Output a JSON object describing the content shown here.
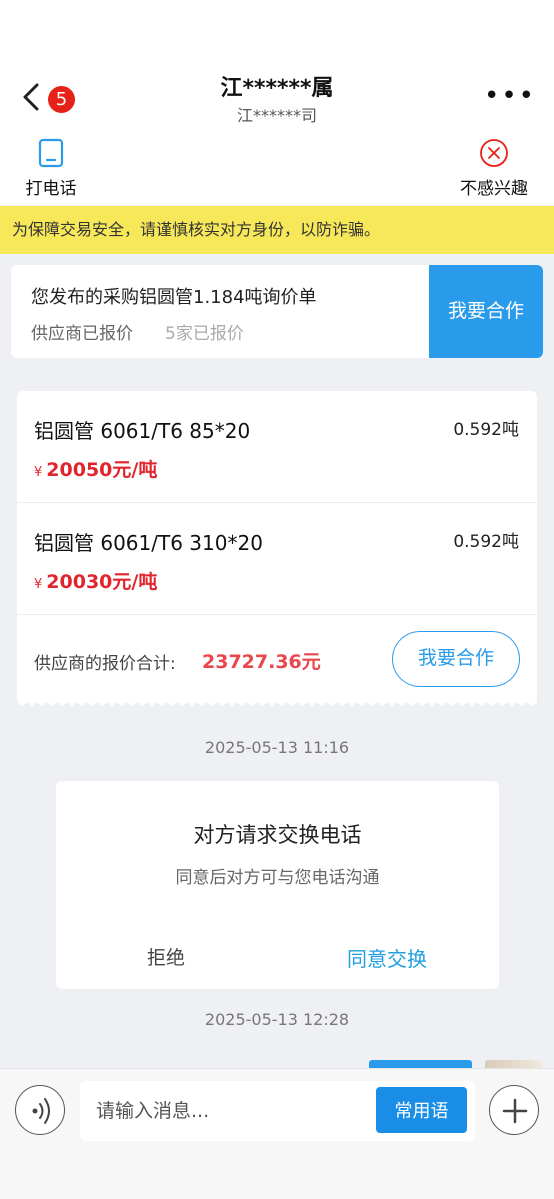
{
  "header": {
    "unread_count": "5",
    "title": "江******属",
    "subtitle": "江******司",
    "more": "•••",
    "call_label": "打电话",
    "not_interested_label": "不感兴趣"
  },
  "warning": "为保障交易安全，请谨慎核实对方身份，以防诈骗。",
  "inquiry": {
    "title": "您发布的采购铝圆管1.184吨询价单",
    "status": "供应商已报价",
    "count": "5家已报价",
    "button": "我要合作"
  },
  "quote": {
    "items": [
      {
        "name": "铝圆管 6061/T6 85*20",
        "qty": "0.592吨",
        "currency": "¥",
        "price": "20050元/吨"
      },
      {
        "name": "铝圆管 6061/T6 310*20",
        "qty": "0.592吨",
        "currency": "¥",
        "price": "20030元/吨"
      }
    ],
    "total_label": "供应商的报价合计:",
    "total_value": "23727.36元",
    "button": "我要合作"
  },
  "timestamps": [
    "2025-05-13 11:16",
    "2025-05-13 12:28"
  ],
  "exchange": {
    "title": "对方请求交换电话",
    "subtitle": "同意后对方可与您电话沟通",
    "reject": "拒绝",
    "agree": "同意交换"
  },
  "input": {
    "placeholder": "请输入消息...",
    "phrases_button": "常用语"
  },
  "colors": {
    "accent": "#2a9bea",
    "price_red": "#e0252c",
    "warning_bg": "#f7e85a",
    "badge_red": "#e62117"
  }
}
